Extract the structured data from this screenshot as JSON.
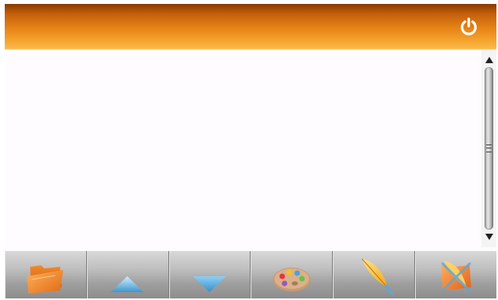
{
  "titlebar": {
    "power_icon": "power-icon"
  },
  "scrollbar": {
    "up_icon": "arrow-up-icon",
    "down_icon": "arrow-down-icon",
    "position": 0
  },
  "toolbar": {
    "buttons": [
      {
        "icon": "folder-icon"
      },
      {
        "icon": "triangle-up-icon"
      },
      {
        "icon": "triangle-down-icon"
      },
      {
        "icon": "palette-icon"
      },
      {
        "icon": "feather-pen-icon"
      },
      {
        "icon": "eraser-cross-icon"
      }
    ]
  },
  "colors": {
    "titlebar_top": "#8a3a00",
    "titlebar_bottom": "#fbbd52",
    "toolbar": "#bdbdbd",
    "arrow_blue": "#5aa9d8"
  }
}
